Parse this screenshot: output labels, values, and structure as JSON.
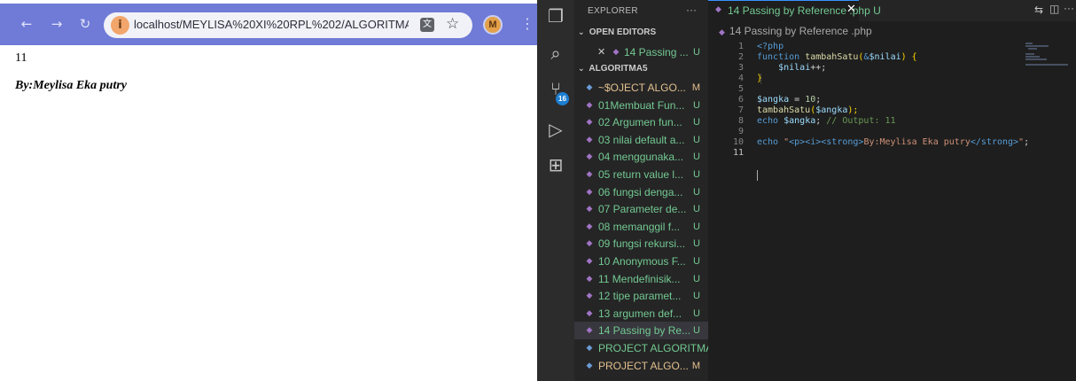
{
  "browser": {
    "back_icon": "←",
    "forward_icon": "→",
    "reload_icon": "↻",
    "site_info_icon": "i",
    "url": "localhost/MEYLISA%20XI%20RPL%202/ALGORITMA5/14...",
    "translate_icon": "文",
    "star_icon": "☆",
    "profile_initial": "M",
    "menu_icon": "⋮",
    "page": {
      "output": "11",
      "author": "By:Meylisa Eka putry"
    }
  },
  "vscode": {
    "activity_icons": {
      "explorer": "❐",
      "search": "⌕",
      "source_control": "⑂",
      "run_debug": "▷",
      "extensions": "⊞"
    },
    "scm_badge": "16",
    "explorer_title": "EXPLORER",
    "explorer_more": "···",
    "open_editors": {
      "header": "OPEN EDITORS",
      "chevron": "⌄",
      "items": [
        {
          "close": "✕",
          "name": "14 Passing ...",
          "status": "U"
        }
      ]
    },
    "folder": {
      "header": "ALGORITMA5",
      "chevron": "⌄",
      "files": [
        {
          "name": "~$OJECT ALGO...",
          "status": "M",
          "kind": "proj"
        },
        {
          "name": "01Membuat Fun...",
          "status": "U",
          "kind": "php"
        },
        {
          "name": "02 Argumen fun...",
          "status": "U",
          "kind": "php"
        },
        {
          "name": "03 nilai default a...",
          "status": "U",
          "kind": "php"
        },
        {
          "name": "04 menggunaka...",
          "status": "U",
          "kind": "php"
        },
        {
          "name": "05 return value l...",
          "status": "U",
          "kind": "php"
        },
        {
          "name": "06 fungsi denga...",
          "status": "U",
          "kind": "php"
        },
        {
          "name": "07 Parameter de...",
          "status": "U",
          "kind": "php"
        },
        {
          "name": "08 memanggil f...",
          "status": "U",
          "kind": "php"
        },
        {
          "name": "09 fungsi rekursi...",
          "status": "U",
          "kind": "php"
        },
        {
          "name": "10 Anonymous F...",
          "status": "U",
          "kind": "php"
        },
        {
          "name": "11 Mendefinisik...",
          "status": "U",
          "kind": "php"
        },
        {
          "name": "12 tipe paramet...",
          "status": "U",
          "kind": "php"
        },
        {
          "name": "13 argumen def...",
          "status": "U",
          "kind": "php"
        },
        {
          "name": "14 Passing by Re...",
          "status": "U",
          "kind": "php"
        },
        {
          "name": "PROJECT ALGORITMA...",
          "status": "",
          "kind": "proj"
        },
        {
          "name": "PROJECT ALGO...",
          "status": "M",
          "kind": "proj"
        }
      ]
    },
    "file_icon_glyph": "◆",
    "tab": {
      "label": "14 Passing by Reference .php",
      "status": "U",
      "close_icon": "✕"
    },
    "editor_actions": {
      "split": "⇆",
      "layout": "◫",
      "more": "···"
    },
    "breadcrumb": "14 Passing by Reference .php",
    "line_numbers": [
      "1",
      "2",
      "3",
      "4",
      "5",
      "6",
      "7",
      "8",
      "9",
      "10",
      "11"
    ],
    "code": {
      "l1_open": "<?php",
      "l2_kw": "function",
      "l2_fn": "tambahSatu",
      "l2_paren_open": "(",
      "l2_amp": "&",
      "l2_param": "$nilai",
      "l2_paren_close": ")",
      "l2_brace": " {",
      "l3_indent": "    ",
      "l3_var": "$nilai",
      "l3_op": "++;",
      "l4_brace": "}",
      "l6_var": "$angka",
      "l6_eq": " = ",
      "l6_num": "10",
      "l6_semi": ";",
      "l7_fn": "tambahSatu",
      "l7_open": "(",
      "l7_var": "$angka",
      "l7_close": ");",
      "l8_kw": "echo ",
      "l8_var": "$angka",
      "l8_semi": "; ",
      "l8_comment": "// Output: 11",
      "l10_kw": "echo ",
      "l10_q1": "\"",
      "l10_tags_open": "<p><i><strong>",
      "l10_text": "By:Meylisa Eka putry",
      "l10_tags_close": "</strong>",
      "l10_q2": "\"",
      "l10_semi": ";"
    }
  }
}
